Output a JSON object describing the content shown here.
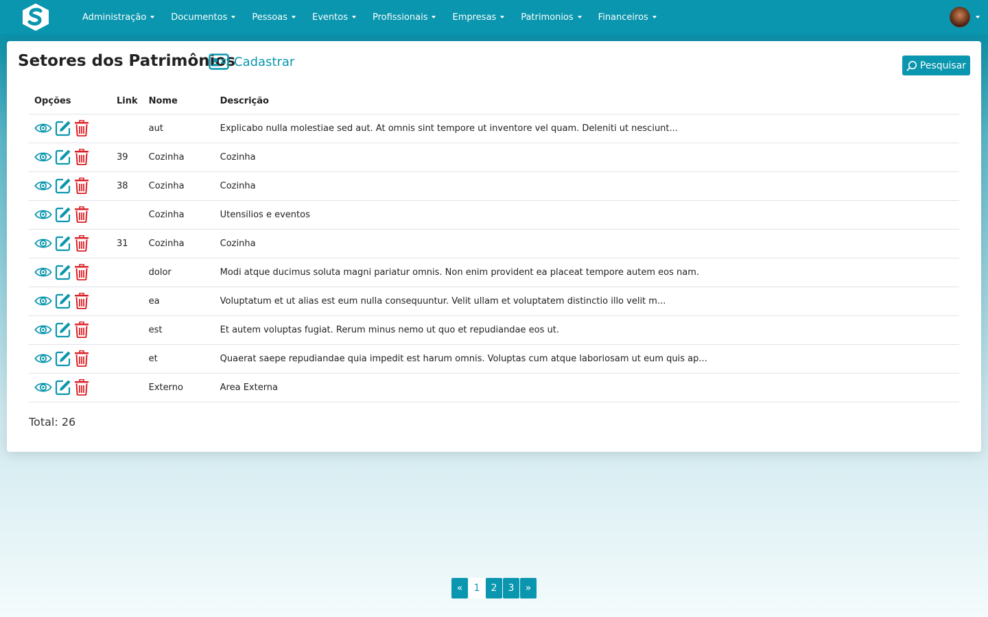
{
  "nav": {
    "items": [
      {
        "label": "Administração"
      },
      {
        "label": "Documentos"
      },
      {
        "label": "Pessoas"
      },
      {
        "label": "Eventos"
      },
      {
        "label": "Profissionais"
      },
      {
        "label": "Empresas"
      },
      {
        "label": "Patrimonios"
      },
      {
        "label": "Financeiros"
      }
    ]
  },
  "header": {
    "title": "Setores dos Patrimônios",
    "register_label": "Cadastrar",
    "search_label": "Pesquisar"
  },
  "table": {
    "headers": {
      "options": "Opções",
      "link": "Link",
      "name": "Nome",
      "description": "Descrição"
    },
    "rows": [
      {
        "link": "",
        "name": "aut",
        "description": "Explicabo nulla molestiae sed aut. At omnis sint tempore ut inventore vel quam. Deleniti ut nesciunt..."
      },
      {
        "link": "39",
        "name": "Cozinha",
        "description": "Cozinha"
      },
      {
        "link": "38",
        "name": "Cozinha",
        "description": "Cozinha"
      },
      {
        "link": "",
        "name": "Cozinha",
        "description": "Utensilios e eventos"
      },
      {
        "link": "31",
        "name": "Cozinha",
        "description": "Cozinha"
      },
      {
        "link": "",
        "name": "dolor",
        "description": "Modi atque ducimus soluta magni pariatur omnis. Non enim provident ea placeat tempore autem eos nam."
      },
      {
        "link": "",
        "name": "ea",
        "description": "Voluptatum et ut alias est eum nulla consequuntur. Velit ullam et voluptatem distinctio illo velit m..."
      },
      {
        "link": "",
        "name": "est",
        "description": "Et autem voluptas fugiat. Rerum minus nemo ut quo et repudiandae eos ut."
      },
      {
        "link": "",
        "name": "et",
        "description": "Quaerat saepe repudiandae quia impedit est harum omnis. Voluptas cum atque laboriosam ut eum quis ap..."
      },
      {
        "link": "",
        "name": "Externo",
        "description": "Area Externa"
      }
    ]
  },
  "footer": {
    "total": "Total: 26"
  },
  "pagination": {
    "prev": "«",
    "pages": [
      "1",
      "2",
      "3"
    ],
    "active": "1",
    "next": "»"
  },
  "icons": {
    "logo": "s-logo-icon",
    "view": "eye-icon",
    "edit": "edit-icon",
    "delete": "trash-icon",
    "register": "id-card-icon",
    "search": "search-icon"
  },
  "colors": {
    "primary": "#0996ae",
    "danger": "#dc1f26"
  }
}
